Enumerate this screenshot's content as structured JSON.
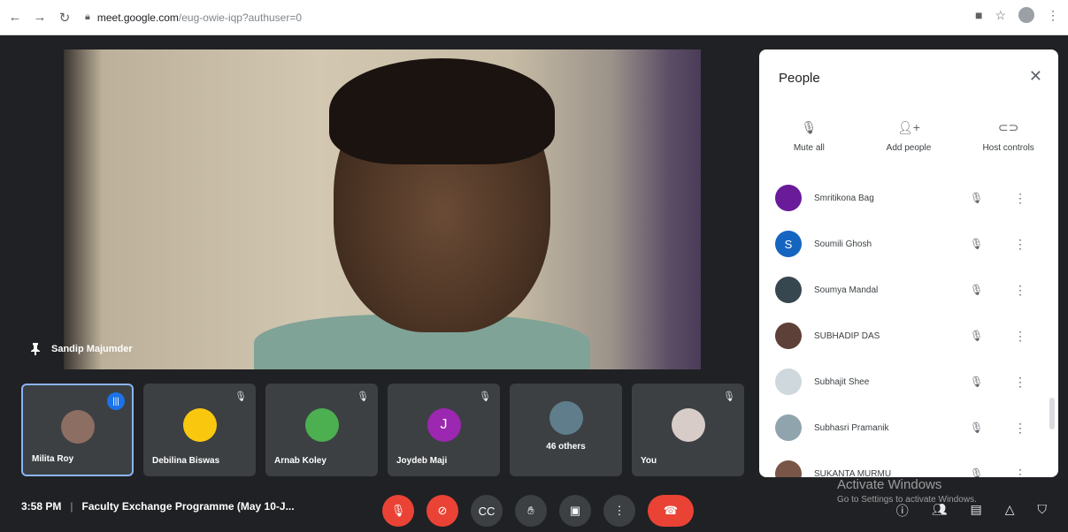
{
  "browser": {
    "url_host": "meet.google.com",
    "url_path": "/eug-owie-iqp?authuser=0"
  },
  "main_speaker": {
    "name": "Sandip Majumder"
  },
  "tiles": [
    {
      "name": "Milita Roy",
      "status": "speaking",
      "avatar_color": "#8d6e63"
    },
    {
      "name": "Debilina Biswas",
      "status": "muted",
      "avatar_color": "#f9c80e"
    },
    {
      "name": "Arnab Koley",
      "status": "muted",
      "avatar_color": "#4caf50"
    },
    {
      "name": "Joydeb Maji",
      "status": "muted",
      "avatar_color": "#9c27b0",
      "initial": "J"
    },
    {
      "label": "46 others",
      "status": "muted",
      "avatar_color": "#607d8b"
    },
    {
      "name": "You",
      "status": "muted",
      "avatar_color": "#d7ccc8"
    }
  ],
  "meeting": {
    "time": "3:58 PM",
    "title": "Faculty Exchange Programme (May 10-J..."
  },
  "panel": {
    "title": "People",
    "actions": [
      {
        "label": "Mute all",
        "icon": "mic-off-icon"
      },
      {
        "label": "Add people",
        "icon": "add-person-icon"
      },
      {
        "label": "Host controls",
        "icon": "toggle-icon"
      }
    ],
    "people": [
      {
        "name": "Smritikona Bag",
        "avatar_color": "#6a1b9a"
      },
      {
        "name": "Soumili Ghosh",
        "avatar_color": "#1565c0",
        "initial": "S"
      },
      {
        "name": "Soumya Mandal",
        "avatar_color": "#37474f"
      },
      {
        "name": "SUBHADIP DAS",
        "avatar_color": "#5d4037"
      },
      {
        "name": "Subhajit Shee",
        "avatar_color": "#cfd8dc"
      },
      {
        "name": "Subhasri Pramanik",
        "avatar_color": "#90a4ae"
      },
      {
        "name": "SUKANTA MURMU",
        "avatar_color": "#795548"
      }
    ]
  },
  "watermark": {
    "title": "Activate Windows",
    "subtitle": "Go to Settings to activate Windows."
  },
  "colors": {
    "background": "#202124",
    "end_call": "#ea4335",
    "accent": "#1a73e8"
  }
}
